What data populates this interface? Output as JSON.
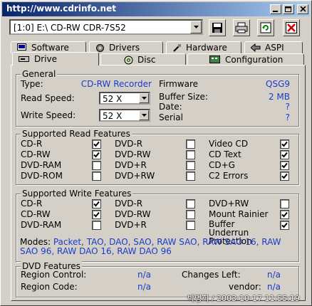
{
  "window": {
    "title": "http://www.cdrinfo.net"
  },
  "toolbar": {
    "drive": "[1:0]  E:\\ CD-RW    CDR-7S52"
  },
  "tabs_top": [
    {
      "label": "Software"
    },
    {
      "label": "Drivers"
    },
    {
      "label": "Hardware"
    },
    {
      "label": "ASPI"
    }
  ],
  "tabs_bottom": [
    {
      "label": "Drive"
    },
    {
      "label": "Disc"
    },
    {
      "label": "Configuration"
    }
  ],
  "general": {
    "title": "General",
    "type_label": "Type:",
    "type_value": "CD-RW Recorder",
    "firmware_label": "Firmware",
    "firmware_value": "QSG9",
    "read_speed_label": "Read Speed:",
    "read_speed_value": "52 X",
    "buffer_label": "Buffer Size:",
    "buffer_value": "2 MB",
    "date_label": "Date:",
    "date_value": "?",
    "write_speed_label": "Write Speed:",
    "write_speed_value": "52 X",
    "serial_label": "Serial",
    "serial_value": "?"
  },
  "read_features": {
    "title": "Supported Read Features",
    "items": [
      {
        "label": "CD-R",
        "checked": true
      },
      {
        "label": "DVD-R",
        "checked": false
      },
      {
        "label": "Video CD",
        "checked": true
      },
      {
        "label": "CD-RW",
        "checked": true
      },
      {
        "label": "DVD-RW",
        "checked": false
      },
      {
        "label": "CD Text",
        "checked": true
      },
      {
        "label": "DVD-RAM",
        "checked": false
      },
      {
        "label": "DVD+R",
        "checked": false
      },
      {
        "label": "CD+G",
        "checked": true
      },
      {
        "label": "DVD-ROM",
        "checked": false
      },
      {
        "label": "DVD+RW",
        "checked": false
      },
      {
        "label": "C2 Errors",
        "checked": true
      }
    ]
  },
  "write_features": {
    "title": "Supported Write Features",
    "items": [
      {
        "label": "CD-R",
        "checked": true
      },
      {
        "label": "DVD-R",
        "checked": false
      },
      {
        "label": "DVD+RW",
        "checked": false
      },
      {
        "label": "CD-RW",
        "checked": true
      },
      {
        "label": "DVD-RW",
        "checked": false
      },
      {
        "label": "Mount Rainier",
        "checked": true
      },
      {
        "label": "DVD-RAM",
        "checked": false
      },
      {
        "label": "DVD+R",
        "checked": false
      },
      {
        "label": "Buffer Underrun Protection",
        "checked": true
      }
    ],
    "modes_label": "Modes:",
    "modes_value": "Packet, TAO, DAO, SAO, RAW SAO, RAW SAO 16, RAW SAO 96, RAW DAO 16, RAW DAO 96"
  },
  "dvd_features": {
    "title": "DVD Features",
    "region_control_label": "Region Control:",
    "region_control_value": "n/a",
    "changes_left_label": "Changes Left:",
    "changes_left_value": "n/a",
    "region_code_label": "Region Code:",
    "region_code_value": "n/a",
    "vendor_label": "vendor:",
    "vendor_value": "n/a"
  },
  "watermark": "박명희 / 2003-10-17 11:55:19",
  "colors": {
    "value_blue": "#1a3cc8",
    "title_start": "#0a246a",
    "title_end": "#a6caf0"
  }
}
